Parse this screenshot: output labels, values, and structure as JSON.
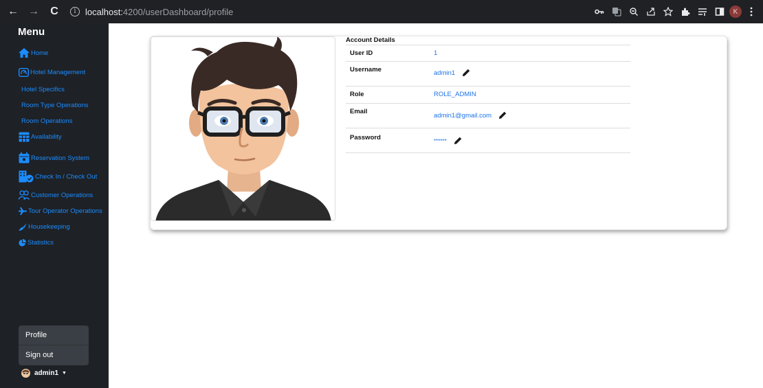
{
  "browser": {
    "url_host": "localhost:",
    "url_rest": "4200/userDashboard/profile",
    "back_icon": "←",
    "forward_icon": "→",
    "reload_icon": "C",
    "profile_initial": "K"
  },
  "sidebar": {
    "title": "Menu",
    "items": [
      {
        "label": "Home",
        "icon": "home-icon"
      },
      {
        "label": "Hotel Management",
        "icon": "hotel-management-icon"
      },
      {
        "label": "Hotel Specifics",
        "icon": ""
      },
      {
        "label": "Room Type Operations",
        "icon": ""
      },
      {
        "label": "Room Operations",
        "icon": ""
      },
      {
        "label": "Availability",
        "icon": "table-icon"
      },
      {
        "label": "Reservation System",
        "icon": "calendar-icon"
      },
      {
        "label": "Check In / Check Out",
        "icon": "building-check-icon"
      },
      {
        "label": "Customer Operations",
        "icon": "users-icon"
      },
      {
        "label": "Tour Operator Operations",
        "icon": "plane-icon"
      },
      {
        "label": "Housekeeping",
        "icon": "broom-icon"
      },
      {
        "label": "Statistics",
        "icon": "pie-chart-icon"
      }
    ],
    "dropdown": {
      "profile": "Profile",
      "signout": "Sign out"
    },
    "username": "admin1"
  },
  "account": {
    "title": "Account Details",
    "rows": [
      {
        "label": "User ID",
        "value": "1",
        "editable": false
      },
      {
        "label": "Username",
        "value": "admin1",
        "editable": true
      },
      {
        "label": "Role",
        "value": "ROLE_ADMIN",
        "editable": false
      },
      {
        "label": "Email",
        "value": "admin1@gmail.com",
        "editable": true
      },
      {
        "label": "Password",
        "value": "******",
        "editable": true
      }
    ]
  },
  "colors": {
    "accent": "#1a8cff",
    "sidebar_bg": "#1e2126",
    "link": "#1a73e8"
  }
}
